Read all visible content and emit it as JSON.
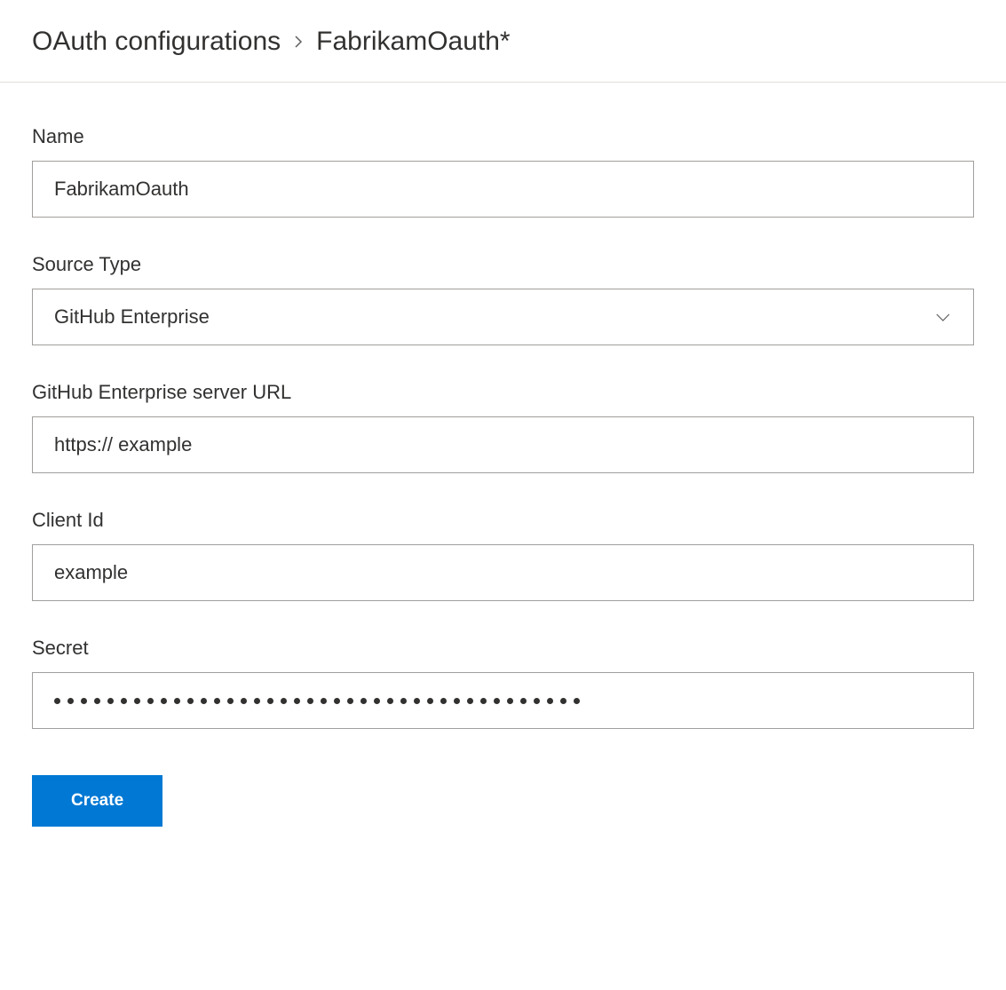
{
  "breadcrumb": {
    "parent": "OAuth configurations",
    "current": "FabrikamOauth*"
  },
  "form": {
    "name": {
      "label": "Name",
      "value": "FabrikamOauth"
    },
    "sourceType": {
      "label": "Source Type",
      "value": "GitHub Enterprise"
    },
    "serverUrl": {
      "label": "GitHub Enterprise server URL",
      "value": "https:// example"
    },
    "clientId": {
      "label": "Client Id",
      "value": "example"
    },
    "secret": {
      "label": "Secret",
      "dotCount": 40
    }
  },
  "actions": {
    "create": "Create"
  }
}
